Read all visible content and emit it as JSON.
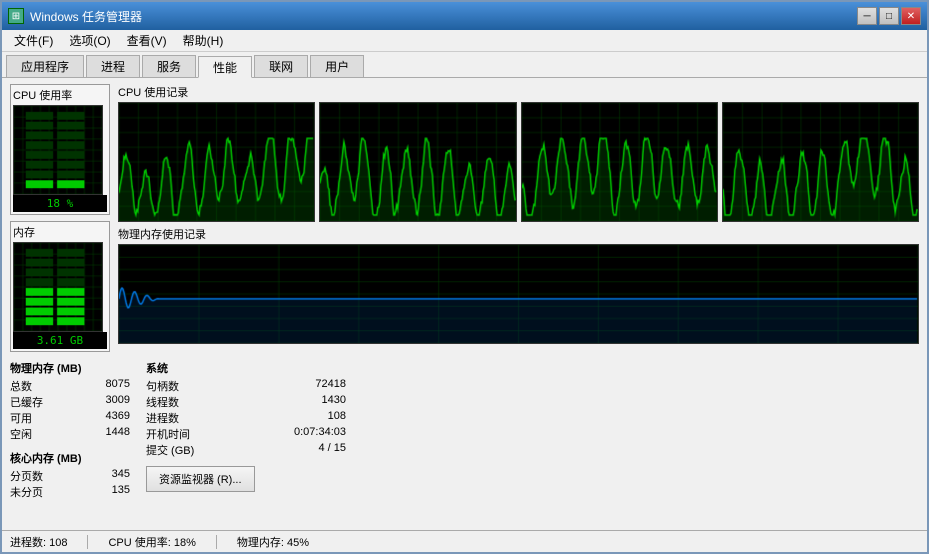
{
  "window": {
    "title": "Windows 任务管理器",
    "icon": "⚙"
  },
  "titleButtons": {
    "minimize": "─",
    "maximize": "□",
    "close": "✕"
  },
  "menu": {
    "items": [
      "文件(F)",
      "选项(O)",
      "查看(V)",
      "帮助(H)"
    ]
  },
  "tabs": {
    "items": [
      "应用程序",
      "进程",
      "服务",
      "性能",
      "联网",
      "用户"
    ],
    "active": 3
  },
  "cpu": {
    "sectionLabel": "CPU 使用记录",
    "gaugeLabel": "CPU 使用率",
    "value": "18 %"
  },
  "memory": {
    "sectionLabel": "物理内存使用记录",
    "gaugeLabel": "内存",
    "value": "3.61 GB"
  },
  "physicalMemory": {
    "title": "物理内存 (MB)",
    "rows": [
      {
        "label": "总数",
        "value": "8075"
      },
      {
        "label": "已缓存",
        "value": "3009"
      },
      {
        "label": "可用",
        "value": "4369"
      },
      {
        "label": "空闲",
        "value": "1448"
      }
    ]
  },
  "coreMemory": {
    "title": "核心内存 (MB)",
    "rows": [
      {
        "label": "分页数",
        "value": "345"
      },
      {
        "label": "未分页",
        "value": "135"
      }
    ]
  },
  "system": {
    "title": "系统",
    "rows": [
      {
        "label": "句柄数",
        "value": "72418"
      },
      {
        "label": "线程数",
        "value": "1430"
      },
      {
        "label": "进程数",
        "value": "108"
      },
      {
        "label": "开机时间",
        "value": "0:07:34:03"
      },
      {
        "label": "提交 (GB)",
        "value": "4 / 15"
      }
    ]
  },
  "resourceBtn": "资源监视器 (R)...",
  "statusBar": {
    "processes": "进程数: 108",
    "cpu": "CPU 使用率: 18%",
    "memory": "物理内存: 45%"
  }
}
